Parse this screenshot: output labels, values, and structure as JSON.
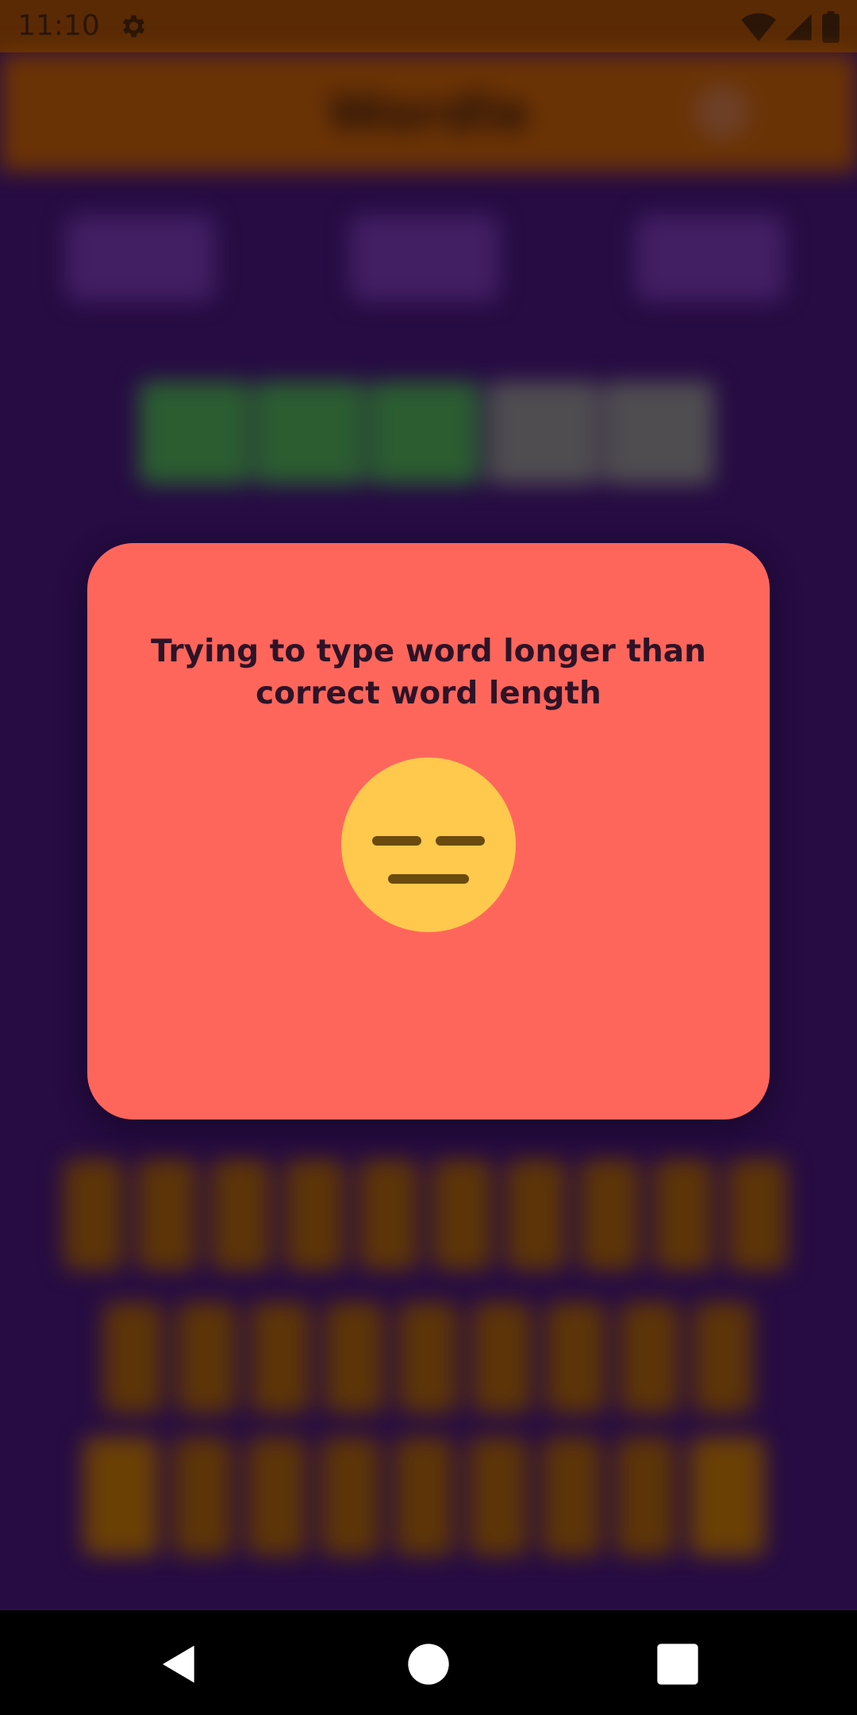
{
  "status": {
    "time": "11:10"
  },
  "app": {
    "title": "Wordle"
  },
  "dialog": {
    "message": "Trying to type word longer than correct word length",
    "emoji": "neutral-face-emoji"
  },
  "colors": {
    "background": "#2a0d4a",
    "dialog": "#ff665b",
    "emoji": "#ffc94d",
    "emoji_features": "#6b4a0e"
  },
  "nav": {
    "back": "back-icon",
    "home": "home-icon",
    "recents": "recents-icon"
  }
}
